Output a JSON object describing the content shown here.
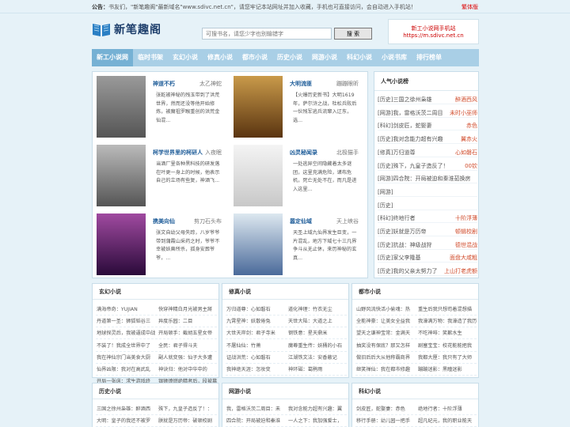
{
  "notice": {
    "label": "公告：",
    "text": "书友们，\"新笔趣阁\"最新域名\"www.sdivc.net.cn\"，请您牢记本站网址并加入收藏，手机也可直接访问，会自动进入手机站！",
    "switch": "繁体版"
  },
  "logo": {
    "name": "新笔趣阁",
    "icon": "book-icon"
  },
  "search": {
    "placeholder": "可搜书名，请您少字也别输错字",
    "button": "搜 索"
  },
  "mobile": {
    "line1": "新工小说网手机站",
    "line2": "https://m.sdivc.net.cn"
  },
  "nav": [
    "新工小说网",
    "临时书架",
    "玄幻小说",
    "修真小说",
    "都市小说",
    "历史小说",
    "网游小说",
    "科幻小说",
    "小说书库",
    "排行榜单"
  ],
  "featured": [
    {
      "title": "神道不朽",
      "author": "太乙神蛇",
      "desc": "张乾被神秘的残玉带到了洪荒世界，然而还没等他开始修炼，被魔祖罗睺重创的洪荒金仙混...",
      "cover": "#6b6b6b",
      "cover_text": "神道不朽"
    },
    {
      "title": "大明流匪",
      "author": "蹦蹦眼昕",
      "desc": "【火爆历史新书】大明1619年，萨尔浒之战，杜松兵败后一伙残军逃兵流窜入辽东，选...",
      "cover": "#8a5a1e",
      "cover_text": "大明流匪"
    },
    {
      "title": "柯学世界里的柯研人",
      "author": "入夜眠",
      "desc": "当酒厂里各种黑科技的研发落在叶更一身上的时候，他表示自己的立场有些复，神酒飞...",
      "cover": "#7a7a7a",
      "cover_text": "柯研人"
    },
    {
      "title": "凶灵秘闻录",
      "author": "北极猫手",
      "desc": "一处逃异空间隐藏着太多谜团，这里充满危险，诸布危机，死亡无处不在，而凡是进入这里...",
      "cover": "#d8d8d8",
      "cover_text": "静无斜面"
    },
    {
      "title": "携美向仙",
      "author": "剪刀石头布",
      "desc": "张文自幼父母失踪，八岁爷爷带到蒲霞山采药之时，爷爷不幸被妖兽所杀，孤身安葬爷爷，...",
      "cover": "#5a2a6a",
      "cover_text": "携美向仙"
    },
    {
      "title": "嚣定仙域",
      "author": "天上峡谷",
      "desc": "天圣上域九仙界发生巨变，一片混乱，地方下域七十三凡界争斗从无止休，来历神秘的玄真...",
      "cover": "#3a5a8a",
      "cover_text": "嚣定仙域"
    }
  ],
  "hot": {
    "title": "人气小说榜",
    "items": [
      {
        "cat": "[历史]",
        "name": "三国之徐州枭雄",
        "author": "醉酒西风"
      },
      {
        "cat": "[网游]",
        "name": "我，雷格沃茨二周目",
        "author": "未时小巫师"
      },
      {
        "cat": "[科幻]",
        "name": "剑皮匠，蛇娶妻",
        "author": "赤色"
      },
      {
        "cat": "[历史]",
        "name": "我对念能力超有兴趣",
        "author": "翼赤火"
      },
      {
        "cat": "[修真]",
        "name": "万归道尊",
        "author": "心如磐石"
      },
      {
        "cat": "[历史]",
        "name": "殊下，九皇子造反了！",
        "author": "00钦"
      },
      {
        "cat": "[网游]",
        "name": "四合院：开局被迫和秦淮茹换房",
        "author": ""
      },
      {
        "cat": "[网游]",
        "name": "",
        "author": ""
      },
      {
        "cat": "[历史]",
        "name": "",
        "author": ""
      },
      {
        "cat": "[科幻]",
        "name": "终地行者",
        "author": "十阶浮薄"
      },
      {
        "cat": "[历史]",
        "name": "妖就是万历帝",
        "author": "顿辑校剧"
      },
      {
        "cat": "[历史]",
        "name": "抗战：神级战狩",
        "author": "德世混战"
      },
      {
        "cat": "[历史]",
        "name": "家父李隆基",
        "author": "面盘大咸粗"
      },
      {
        "cat": "[历史]",
        "name": "我的父亲太努力了",
        "author": "上山打老虎额"
      }
    ]
  },
  "sections": [
    {
      "title": "玄幻小说",
      "items": [
        "满海帝奇：YUJIAN",
        "快穿神精白月光被男主掰",
        "丹道第一圣：狮狐韬谷三",
        "异度乐园：二目",
        "地球探灵后，我被逼成中战",
        "开局顿手：截胡五星女帝",
        "不装了！我成全世界中了",
        "全民：君子得斗夫",
        "我在神仙宗门当美食大厨",
        "副人就变强：仙子大多遭",
        "仙界凶限：我对在高武乱",
        "神诀归：他对中华中的",
        "开局一张床：求生游戏终",
        "银狮燎燃绝精者后，段被篡"
      ]
    },
    {
      "title": "修真小说",
      "items": [
        "万归道尊：心如磐石",
        "道化神理：竹衣无尘",
        "九霄星神：妖散倦兔",
        "天世大陆：大道之上",
        "大世天岸剑：君子寺米",
        "钢铁意：星天鼎米",
        "不屠仙仙：竹萧",
        "魔尊重生传：妖桶的小石",
        "证战洪荒：心如磐石",
        "江湖铁文法：安香蔽记",
        "我神绝天涯：怎妆变",
        "神环磁：葛鹃雨"
      ]
    },
    {
      "title": "都市小说",
      "items": [
        "山野风流快活小偷魂：热",
        "重生后我只想苟着混想描",
        "全能神豪：让美女全益我",
        "我濠满万物：我濠造了我历",
        "望天之谦神宝常：金满天",
        "不吃神啡：笑歉水生",
        "抽奖没有保底？那又怎样",
        "剧塞宝宝：校花能能把我",
        "做旧后后大从他称霸商界",
        "我都大厘：我只有了大师",
        "继笑禅仙：我在都市修趣",
        "蹦蹦迷影：黑瞳迷影"
      ]
    },
    {
      "title": "历史小说",
      "items": [
        "三国之徐州枭雄：醉酒西",
        "殊下，九皇子造反了！：",
        "大明：皇子的我还不被罗",
        "朕就是万历帝：破顿校剧"
      ]
    },
    {
      "title": "网游小说",
      "items": [
        "我，雷格沃茨二周目：未",
        "我对念能力超有兴趣：翼",
        "四合院：开局被迫和秦淮",
        "一人之下：我加强爱士，"
      ]
    },
    {
      "title": "科幻小说",
      "items": [
        "剑皮匠，蛇娶妻：赤色",
        "绝地行者：十阶浮薄",
        "移行手册：幼儿园一把手",
        "超凡纪元，我的职业能天"
      ]
    }
  ]
}
